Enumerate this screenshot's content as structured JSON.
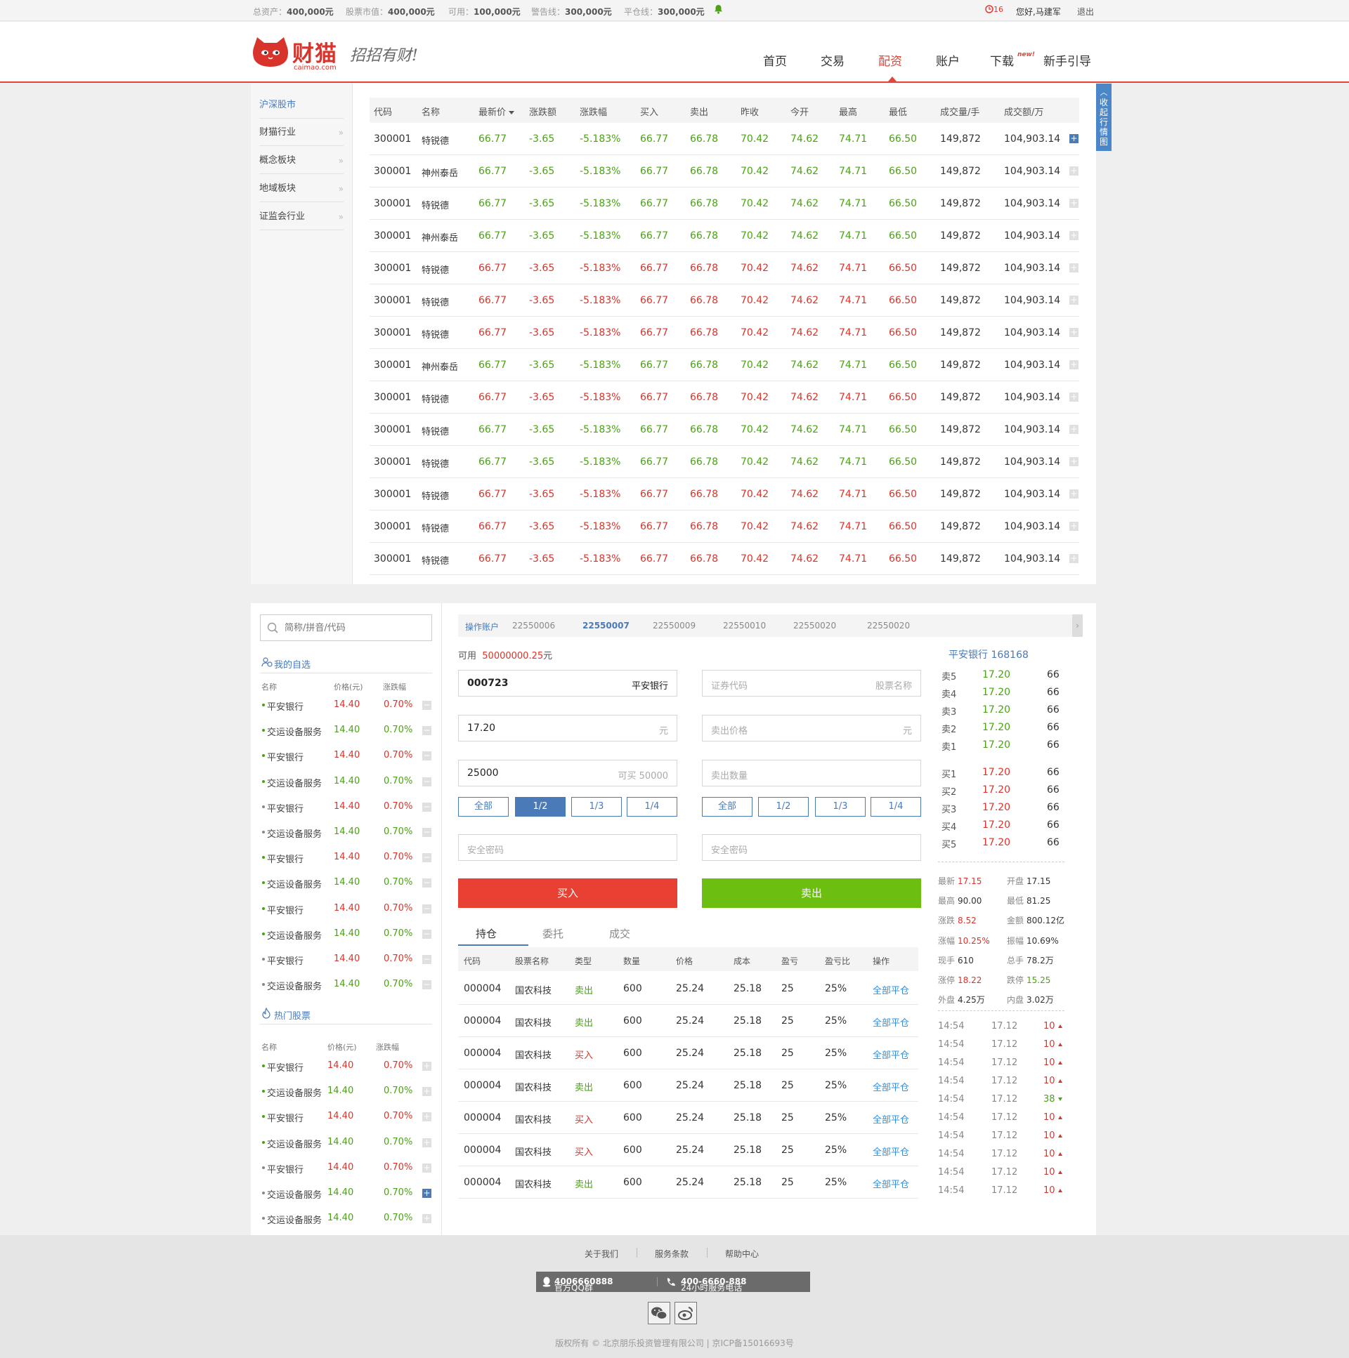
{
  "topbar": {
    "total_assets": {
      "label": "总资产：",
      "value": "400,000元"
    },
    "stock_value": {
      "label": "股票市值：",
      "value": "400,000元"
    },
    "available": {
      "label": "可用：",
      "value": "100,000元"
    },
    "warn_line": {
      "label": "警告线：",
      "value": "300,000元"
    },
    "close_line": {
      "label": "平仓线：",
      "value": "300,000元"
    },
    "clock_count": "16",
    "greeting": "您好,马建军",
    "logout": "退出"
  },
  "header": {
    "brand": "财猫",
    "domain": "caimao.com",
    "slogan": "招招有财!",
    "nav": [
      "首页",
      "交易",
      "配资",
      "账户",
      "下载",
      "新手引导"
    ],
    "nav_active": "配资",
    "new_badge": "new!"
  },
  "sidebar": {
    "items": [
      "沪深股市",
      "财猫行业",
      "概念板块",
      "地域板块",
      "证监会行业"
    ],
    "chevron": "»"
  },
  "side_tab": {
    "label": "收起行情图"
  },
  "market": {
    "columns": [
      "代码",
      "名称",
      "最新价",
      "涨跌额",
      "涨跌幅",
      "买入",
      "卖出",
      "昨收",
      "今开",
      "最高",
      "最低",
      "成交量/手",
      "成交额/万"
    ],
    "rows": [
      {
        "code": "300001",
        "name": "特锐德",
        "last": "66.77",
        "chg": "-3.65",
        "pct": "-5.183%",
        "bid": "66.77",
        "ask": "66.78",
        "prev": "70.42",
        "open": "74.62",
        "high": "74.71",
        "low": "66.50",
        "vol": "149,872",
        "amt": "104,903.14",
        "color": "green",
        "added": true
      },
      {
        "code": "300001",
        "name": "神州泰岳",
        "last": "66.77",
        "chg": "-3.65",
        "pct": "-5.183%",
        "bid": "66.77",
        "ask": "66.78",
        "prev": "70.42",
        "open": "74.62",
        "high": "74.71",
        "low": "66.50",
        "vol": "149,872",
        "amt": "104,903.14",
        "color": "green",
        "added": false
      },
      {
        "code": "300001",
        "name": "特锐德",
        "last": "66.77",
        "chg": "-3.65",
        "pct": "-5.183%",
        "bid": "66.77",
        "ask": "66.78",
        "prev": "70.42",
        "open": "74.62",
        "high": "74.71",
        "low": "66.50",
        "vol": "149,872",
        "amt": "104,903.14",
        "color": "green",
        "added": false
      },
      {
        "code": "300001",
        "name": "神州泰岳",
        "last": "66.77",
        "chg": "-3.65",
        "pct": "-5.183%",
        "bid": "66.77",
        "ask": "66.78",
        "prev": "70.42",
        "open": "74.62",
        "high": "74.71",
        "low": "66.50",
        "vol": "149,872",
        "amt": "104,903.14",
        "color": "green",
        "added": false
      },
      {
        "code": "300001",
        "name": "特锐德",
        "last": "66.77",
        "chg": "-3.65",
        "pct": "-5.183%",
        "bid": "66.77",
        "ask": "66.78",
        "prev": "70.42",
        "open": "74.62",
        "high": "74.71",
        "low": "66.50",
        "vol": "149,872",
        "amt": "104,903.14",
        "color": "red",
        "added": false
      },
      {
        "code": "300001",
        "name": "特锐德",
        "last": "66.77",
        "chg": "-3.65",
        "pct": "-5.183%",
        "bid": "66.77",
        "ask": "66.78",
        "prev": "70.42",
        "open": "74.62",
        "high": "74.71",
        "low": "66.50",
        "vol": "149,872",
        "amt": "104,903.14",
        "color": "red",
        "added": false
      },
      {
        "code": "300001",
        "name": "特锐德",
        "last": "66.77",
        "chg": "-3.65",
        "pct": "-5.183%",
        "bid": "66.77",
        "ask": "66.78",
        "prev": "70.42",
        "open": "74.62",
        "high": "74.71",
        "low": "66.50",
        "vol": "149,872",
        "amt": "104,903.14",
        "color": "red",
        "added": false
      },
      {
        "code": "300001",
        "name": "神州泰岳",
        "last": "66.77",
        "chg": "-3.65",
        "pct": "-5.183%",
        "bid": "66.77",
        "ask": "66.78",
        "prev": "70.42",
        "open": "74.62",
        "high": "74.71",
        "low": "66.50",
        "vol": "149,872",
        "amt": "104,903.14",
        "color": "green",
        "added": false
      },
      {
        "code": "300001",
        "name": "特锐德",
        "last": "66.77",
        "chg": "-3.65",
        "pct": "-5.183%",
        "bid": "66.77",
        "ask": "66.78",
        "prev": "70.42",
        "open": "74.62",
        "high": "74.71",
        "low": "66.50",
        "vol": "149,872",
        "amt": "104,903.14",
        "color": "red",
        "added": false
      },
      {
        "code": "300001",
        "name": "特锐德",
        "last": "66.77",
        "chg": "-3.65",
        "pct": "-5.183%",
        "bid": "66.77",
        "ask": "66.78",
        "prev": "70.42",
        "open": "74.62",
        "high": "74.71",
        "low": "66.50",
        "vol": "149,872",
        "amt": "104,903.14",
        "color": "green",
        "added": false
      },
      {
        "code": "300001",
        "name": "特锐德",
        "last": "66.77",
        "chg": "-3.65",
        "pct": "-5.183%",
        "bid": "66.77",
        "ask": "66.78",
        "prev": "70.42",
        "open": "74.62",
        "high": "74.71",
        "low": "66.50",
        "vol": "149,872",
        "amt": "104,903.14",
        "color": "green",
        "added": false
      },
      {
        "code": "300001",
        "name": "特锐德",
        "last": "66.77",
        "chg": "-3.65",
        "pct": "-5.183%",
        "bid": "66.77",
        "ask": "66.78",
        "prev": "70.42",
        "open": "74.62",
        "high": "74.71",
        "low": "66.50",
        "vol": "149,872",
        "amt": "104,903.14",
        "color": "red",
        "added": false
      },
      {
        "code": "300001",
        "name": "特锐德",
        "last": "66.77",
        "chg": "-3.65",
        "pct": "-5.183%",
        "bid": "66.77",
        "ask": "66.78",
        "prev": "70.42",
        "open": "74.62",
        "high": "74.71",
        "low": "66.50",
        "vol": "149,872",
        "amt": "104,903.14",
        "color": "red",
        "added": false
      },
      {
        "code": "300001",
        "name": "特锐德",
        "last": "66.77",
        "chg": "-3.65",
        "pct": "-5.183%",
        "bid": "66.77",
        "ask": "66.78",
        "prev": "70.42",
        "open": "74.62",
        "high": "74.71",
        "low": "66.50",
        "vol": "149,872",
        "amt": "104,903.14",
        "color": "red",
        "added": false
      }
    ]
  },
  "watchlist": {
    "search_placeholder": "简称/拼音/代码",
    "mine_title": "我的自选",
    "hot_title": "热门股票",
    "col_name": "名称",
    "col_price": "价格(元)",
    "col_pct": "涨跌幅",
    "mine": [
      {
        "name": "平安银行",
        "price": "14.40",
        "pct": "0.70%",
        "color": "red",
        "dot": "green"
      },
      {
        "name": "交运设备服务",
        "price": "14.40",
        "pct": "0.70%",
        "color": "green",
        "dot": "green"
      },
      {
        "name": "平安银行",
        "price": "14.40",
        "pct": "0.70%",
        "color": "red",
        "dot": "green"
      },
      {
        "name": "交运设备服务",
        "price": "14.40",
        "pct": "0.70%",
        "color": "green",
        "dot": "green"
      },
      {
        "name": "平安银行",
        "price": "14.40",
        "pct": "0.70%",
        "color": "red",
        "dot": "grey"
      },
      {
        "name": "交运设备服务",
        "price": "14.40",
        "pct": "0.70%",
        "color": "green",
        "dot": "grey"
      },
      {
        "name": "平安银行",
        "price": "14.40",
        "pct": "0.70%",
        "color": "red",
        "dot": "green"
      },
      {
        "name": "交运设备服务",
        "price": "14.40",
        "pct": "0.70%",
        "color": "green",
        "dot": "green"
      },
      {
        "name": "平安银行",
        "price": "14.40",
        "pct": "0.70%",
        "color": "red",
        "dot": "green"
      },
      {
        "name": "交运设备服务",
        "price": "14.40",
        "pct": "0.70%",
        "color": "green",
        "dot": "green"
      },
      {
        "name": "平安银行",
        "price": "14.40",
        "pct": "0.70%",
        "color": "red",
        "dot": "grey"
      },
      {
        "name": "交运设备服务",
        "price": "14.40",
        "pct": "0.70%",
        "color": "green",
        "dot": "grey"
      }
    ],
    "hot": [
      {
        "name": "平安银行",
        "price": "14.40",
        "pct": "0.70%",
        "color": "red",
        "dot": "green",
        "added": false
      },
      {
        "name": "交运设备服务",
        "price": "14.40",
        "pct": "0.70%",
        "color": "green",
        "dot": "green",
        "added": false
      },
      {
        "name": "平安银行",
        "price": "14.40",
        "pct": "0.70%",
        "color": "red",
        "dot": "green",
        "added": false
      },
      {
        "name": "交运设备服务",
        "price": "14.40",
        "pct": "0.70%",
        "color": "green",
        "dot": "green",
        "added": false
      },
      {
        "name": "平安银行",
        "price": "14.40",
        "pct": "0.70%",
        "color": "red",
        "dot": "grey",
        "added": false
      },
      {
        "name": "交运设备服务",
        "price": "14.40",
        "pct": "0.70%",
        "color": "green",
        "dot": "grey",
        "added": true
      },
      {
        "name": "交运设备服务",
        "price": "14.40",
        "pct": "0.70%",
        "color": "green",
        "dot": "grey",
        "added": false
      }
    ]
  },
  "accounts": {
    "label": "操作账户",
    "list": [
      "22550006",
      "22550007",
      "22550009",
      "22550010",
      "22550020",
      "22550020"
    ],
    "selected": "22550007",
    "more": "›"
  },
  "order": {
    "avail_label": "可用",
    "avail_value": "50000000.25",
    "avail_unit": "元",
    "buy": {
      "code": "000723",
      "stock_name": "平安银行",
      "price": "17.20",
      "price_unit": "元",
      "qty": "25000",
      "qty_hint": "可买 50000",
      "quick": [
        "全部",
        "1/2",
        "1/3",
        "1/4"
      ],
      "quick_active": "1/2",
      "password_placeholder": "安全密码",
      "submit": "买入"
    },
    "sell": {
      "code_placeholder": "证券代码",
      "name_placeholder": "股票名称",
      "price_placeholder": "卖出价格",
      "price_unit": "元",
      "qty_placeholder": "卖出数量",
      "quick": [
        "全部",
        "1/2",
        "1/3",
        "1/4"
      ],
      "password_placeholder": "安全密码",
      "submit": "卖出"
    },
    "buy_color": "#e84133",
    "sell_color": "#6cbf10"
  },
  "positions": {
    "tabs": [
      "持仓",
      "委托",
      "成交"
    ],
    "active_tab": "持仓",
    "columns": [
      "代码",
      "股票名称",
      "类型",
      "数量",
      "价格",
      "成本",
      "盈亏",
      "盈亏比",
      "操作"
    ],
    "rows": [
      {
        "code": "000004",
        "name": "国农科技",
        "type": "卖出",
        "qty": "600",
        "price": "25.24",
        "cost": "25.18",
        "pl": "25",
        "plr": "25%",
        "op": "全部平仓"
      },
      {
        "code": "000004",
        "name": "国农科技",
        "type": "卖出",
        "qty": "600",
        "price": "25.24",
        "cost": "25.18",
        "pl": "25",
        "plr": "25%",
        "op": "全部平仓"
      },
      {
        "code": "000004",
        "name": "国农科技",
        "type": "买入",
        "qty": "600",
        "price": "25.24",
        "cost": "25.18",
        "pl": "25",
        "plr": "25%",
        "op": "全部平仓"
      },
      {
        "code": "000004",
        "name": "国农科技",
        "type": "卖出",
        "qty": "600",
        "price": "25.24",
        "cost": "25.18",
        "pl": "25",
        "plr": "25%",
        "op": "全部平仓"
      },
      {
        "code": "000004",
        "name": "国农科技",
        "type": "买入",
        "qty": "600",
        "price": "25.24",
        "cost": "25.18",
        "pl": "25",
        "plr": "25%",
        "op": "全部平仓"
      },
      {
        "code": "000004",
        "name": "国农科技",
        "type": "买入",
        "qty": "600",
        "price": "25.24",
        "cost": "25.18",
        "pl": "25",
        "plr": "25%",
        "op": "全部平仓"
      },
      {
        "code": "000004",
        "name": "国农科技",
        "type": "卖出",
        "qty": "600",
        "price": "25.24",
        "cost": "25.18",
        "pl": "25",
        "plr": "25%",
        "op": "全部平仓"
      }
    ]
  },
  "quote": {
    "title": "平安银行 168168",
    "sells": [
      {
        "label": "卖5",
        "price": "17.20",
        "qty": "66"
      },
      {
        "label": "卖4",
        "price": "17.20",
        "qty": "66"
      },
      {
        "label": "卖3",
        "price": "17.20",
        "qty": "66"
      },
      {
        "label": "卖2",
        "price": "17.20",
        "qty": "66"
      },
      {
        "label": "卖1",
        "price": "17.20",
        "qty": "66"
      }
    ],
    "buys": [
      {
        "label": "买1",
        "price": "17.20",
        "qty": "66"
      },
      {
        "label": "买2",
        "price": "17.20",
        "qty": "66"
      },
      {
        "label": "买3",
        "price": "17.20",
        "qty": "66"
      },
      {
        "label": "买4",
        "price": "17.20",
        "qty": "66"
      },
      {
        "label": "买5",
        "price": "17.20",
        "qty": "66"
      }
    ],
    "stats": [
      {
        "label": "最新",
        "value": "17.15",
        "color": "red"
      },
      {
        "label": "开盘",
        "value": "17.15",
        "color": "dark"
      },
      {
        "label": "最高",
        "value": "90.00",
        "color": "dark"
      },
      {
        "label": "最低",
        "value": "81.25",
        "color": "dark"
      },
      {
        "label": "涨跌",
        "value": "8.52",
        "color": "red"
      },
      {
        "label": "金额",
        "value": "800.12亿",
        "color": "dark"
      },
      {
        "label": "涨幅",
        "value": "10.25%",
        "color": "red"
      },
      {
        "label": "振幅",
        "value": "10.69%",
        "color": "dark"
      },
      {
        "label": "现手",
        "value": "610",
        "color": "dark"
      },
      {
        "label": "总手",
        "value": "78.2万",
        "color": "dark"
      },
      {
        "label": "涨停",
        "value": "18.22",
        "color": "red"
      },
      {
        "label": "跌停",
        "value": "15.25",
        "color": "green"
      },
      {
        "label": "外盘",
        "value": "4.25万",
        "color": "dark"
      },
      {
        "label": "内盘",
        "value": "3.02万",
        "color": "dark"
      }
    ],
    "ticks": [
      {
        "time": "14:54",
        "price": "17.12",
        "vol": "10",
        "dir": "up"
      },
      {
        "time": "14:54",
        "price": "17.12",
        "vol": "10",
        "dir": "up"
      },
      {
        "time": "14:54",
        "price": "17.12",
        "vol": "10",
        "dir": "up"
      },
      {
        "time": "14:54",
        "price": "17.12",
        "vol": "10",
        "dir": "up"
      },
      {
        "time": "14:54",
        "price": "17.12",
        "vol": "38",
        "dir": "down"
      },
      {
        "time": "14:54",
        "price": "17.12",
        "vol": "10",
        "dir": "up"
      },
      {
        "time": "14:54",
        "price": "17.12",
        "vol": "10",
        "dir": "up"
      },
      {
        "time": "14:54",
        "price": "17.12",
        "vol": "10",
        "dir": "up"
      },
      {
        "time": "14:54",
        "price": "17.12",
        "vol": "10",
        "dir": "up"
      },
      {
        "time": "14:54",
        "price": "17.12",
        "vol": "10",
        "dir": "up"
      }
    ]
  },
  "footer": {
    "links": [
      "关于我们",
      "服务条款",
      "帮助中心"
    ],
    "qq_label": "官方QQ群",
    "qq_value": "4006660888",
    "phone_label": "24小时服务电话",
    "phone_value": "400-6660-888",
    "copyright": "版权所有 © 北京朋乐投资管理有限公司  |  京ICP备15016693号"
  },
  "colors": {
    "accent": "#e0463a",
    "up": "#d9342b",
    "down": "#4aa312",
    "link": "#4a7ab8"
  }
}
